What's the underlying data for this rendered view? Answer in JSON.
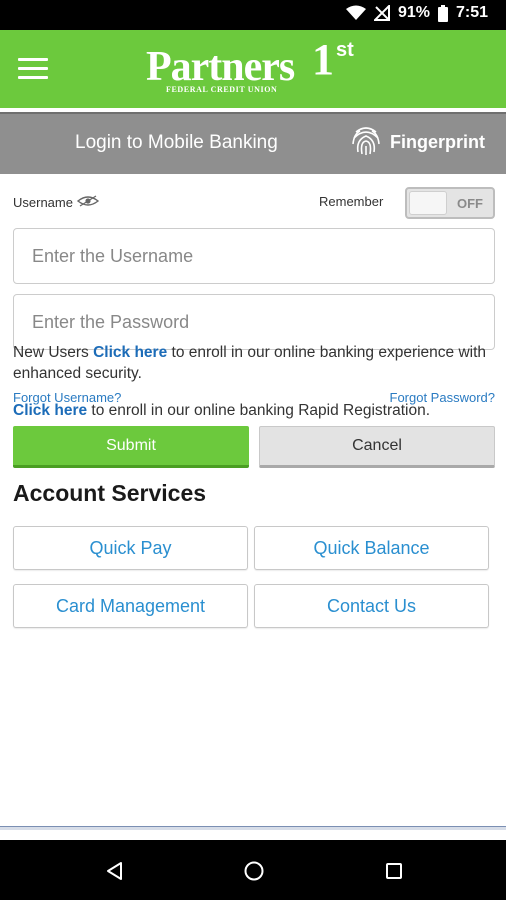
{
  "status_bar": {
    "battery_percent": "91%",
    "time": "7:51",
    "icons": [
      "wifi-icon",
      "no-signal-icon",
      "battery-icon"
    ]
  },
  "header": {
    "menu_icon": "hamburger-menu-icon",
    "logo": {
      "brand": "Partners",
      "numeral": "1",
      "ordinal": "st",
      "subtitle": "FEDERAL CREDIT UNION"
    },
    "brand_color": "#6cc93d"
  },
  "subheader": {
    "title": "Login to Mobile Banking",
    "fingerprint_label": "Fingerprint",
    "fingerprint_icon": "fingerprint-icon",
    "background": "#8f8f8f"
  },
  "login": {
    "username_label": "Username",
    "username_hint_icon": "eye-icon",
    "remember_label": "Remember",
    "remember_toggle": "OFF",
    "username_placeholder": "Enter the Username",
    "password_placeholder": "Enter the Password",
    "forgot_username": "Forgot Username?",
    "forgot_password": "Forgot Password?",
    "submit_label": "Submit",
    "cancel_label": "Cancel"
  },
  "info": {
    "line1_prefix": "New Users",
    "line1_link": "Click here",
    "line1_suffix": "to enroll in our online banking experience with enhanced security.",
    "line2_link": "Click here",
    "line2_suffix": "to enroll in our online banking Rapid Registration.",
    "link_color": "#1c6cb8"
  },
  "account_services": {
    "title": "Account Services",
    "buttons": [
      {
        "label": "Quick Pay"
      },
      {
        "label": "Quick Balance"
      },
      {
        "label": "Card Management"
      },
      {
        "label": "Contact Us"
      }
    ]
  },
  "nav_bar": {
    "icons": [
      "back-icon",
      "home-icon",
      "recent-apps-icon"
    ]
  }
}
